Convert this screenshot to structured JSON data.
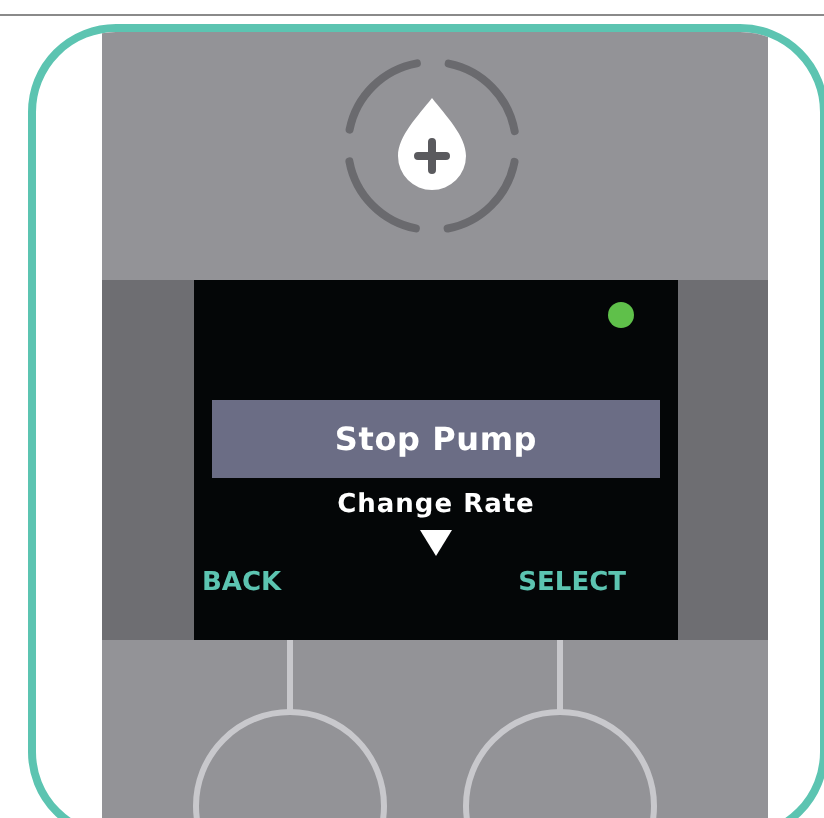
{
  "status_indicator": {
    "color": "#5fc04a"
  },
  "menu": {
    "items": [
      {
        "label": "Stop Pump",
        "selected": true
      },
      {
        "label": "Change Rate",
        "selected": false
      }
    ]
  },
  "softkeys": [
    {
      "label": "BACK"
    },
    {
      "label": "SELECT"
    }
  ]
}
